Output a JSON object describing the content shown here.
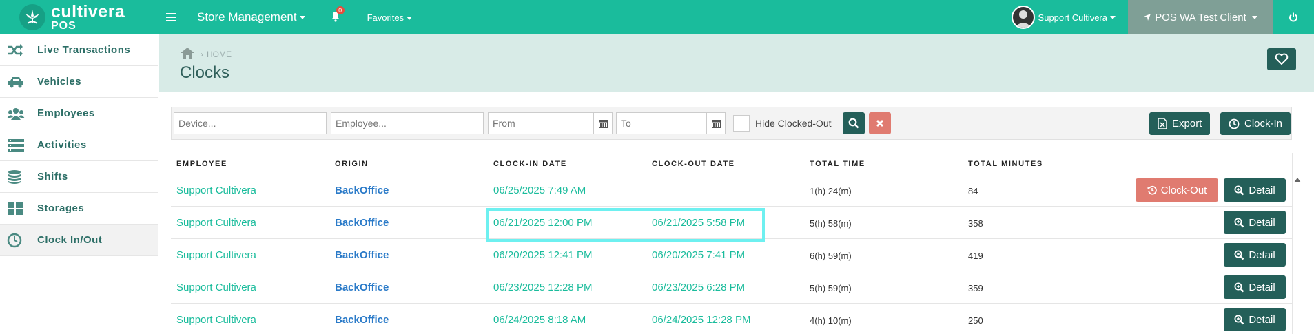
{
  "topbar": {
    "logo_line1": "cultivera",
    "logo_line2": "POS",
    "store_menu": "Store Management",
    "notif_count": "0",
    "favorites": "Favorites",
    "user_name": "Support Cultivera",
    "client_name": "POS WA Test Client",
    "bg_color": "#1abc9c"
  },
  "sidebar": {
    "items": [
      {
        "label": "Live Transactions",
        "icon": "shuffle-icon"
      },
      {
        "label": "Vehicles",
        "icon": "car-icon"
      },
      {
        "label": "Employees",
        "icon": "users-icon"
      },
      {
        "label": "Activities",
        "icon": "list-icon"
      },
      {
        "label": "Shifts",
        "icon": "database-icon"
      },
      {
        "label": "Storages",
        "icon": "grid-icon"
      },
      {
        "label": "Clock In/Out",
        "icon": "clock-icon"
      }
    ]
  },
  "header": {
    "breadcrumb": "HOME",
    "title": "Clocks"
  },
  "filters": {
    "device_placeholder": "Device...",
    "employee_placeholder": "Employee...",
    "from_placeholder": "From",
    "to_placeholder": "To",
    "hide_label": "Hide Clocked-Out",
    "export_label": "Export",
    "clockin_label": "Clock-In"
  },
  "table": {
    "columns": [
      "EMPLOYEE",
      "ORIGIN",
      "CLOCK-IN DATE",
      "CLOCK-OUT DATE",
      "TOTAL TIME",
      "TOTAL MINUTES"
    ],
    "clockout_label": "Clock-Out",
    "detail_label": "Detail",
    "rows": [
      {
        "employee": "Support Cultivera",
        "origin": "BackOffice",
        "clock_in": "06/25/2025 7:49 AM",
        "clock_out": "",
        "total_time": "1(h) 24(m)",
        "total_minutes": "84"
      },
      {
        "employee": "Support Cultivera",
        "origin": "BackOffice",
        "clock_in": "06/21/2025 12:00 PM",
        "clock_out": "06/21/2025 5:58 PM",
        "total_time": "5(h) 58(m)",
        "total_minutes": "358"
      },
      {
        "employee": "Support Cultivera",
        "origin": "BackOffice",
        "clock_in": "06/20/2025 12:41 PM",
        "clock_out": "06/20/2025 7:41 PM",
        "total_time": "6(h) 59(m)",
        "total_minutes": "419"
      },
      {
        "employee": "Support Cultivera",
        "origin": "BackOffice",
        "clock_in": "06/23/2025 12:28 PM",
        "clock_out": "06/23/2025 6:28 PM",
        "total_time": "5(h) 59(m)",
        "total_minutes": "359"
      },
      {
        "employee": "Support Cultivera",
        "origin": "BackOffice",
        "clock_in": "06/24/2025 8:18 AM",
        "clock_out": "06/24/2025 12:28 PM",
        "total_time": "4(h) 10(m)",
        "total_minutes": "250"
      }
    ]
  }
}
